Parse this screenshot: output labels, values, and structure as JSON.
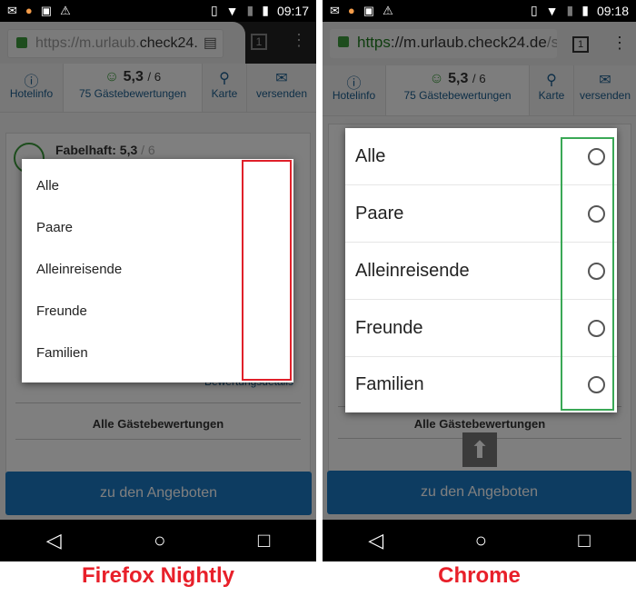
{
  "panels": [
    {
      "browser": "Firefox Nightly",
      "status": {
        "time": "09:17",
        "icons": [
          "gmail-icon",
          "cpu-icon",
          "android-icon",
          "warning-icon",
          "vibrate-icon",
          "wifi-icon",
          "no-sim-icon",
          "battery-icon"
        ]
      },
      "url": {
        "scheme": "https://",
        "host_start": "m.urlaub.",
        "host_main": "check24.",
        "rest": ""
      },
      "tab_count": "1",
      "nav_tabs": [
        {
          "label": "Hotelinfo",
          "icon": "info-icon"
        },
        {
          "score": "5,3",
          "of": "/ 6",
          "label": "75 Gästebewertungen",
          "icon": "smiley-icon"
        },
        {
          "label": "Karte",
          "icon": "map-pin-icon"
        },
        {
          "label": "versenden",
          "icon": "mail-icon"
        }
      ],
      "rating_title": "Fabelhaft: 5,3",
      "rating_of": "/ 6",
      "details_link": "Bewertungsdetails",
      "all_reviews": "Alle Gästebewertungen",
      "cta": "zu den Angeboten",
      "options": [
        "Alle",
        "Paare",
        "Alleinreisende",
        "Freunde",
        "Familien"
      ],
      "highlight_color": "#e0202a"
    },
    {
      "browser": "Chrome",
      "status": {
        "time": "09:18"
      },
      "url": {
        "scheme": "https",
        "host": "://m.urlaub.check24.de",
        "rest": "/s"
      },
      "tab_count": "1",
      "nav_tabs": [
        {
          "label": "Hotelinfo"
        },
        {
          "score": "5,3",
          "of": "/ 6",
          "label": "75 Gästebewertungen"
        },
        {
          "label": "Karte"
        },
        {
          "label": "versenden"
        }
      ],
      "all_reviews": "Alle Gästebewertungen",
      "cta": "zu den Angeboten",
      "options": [
        "Alle",
        "Paare",
        "Alleinreisende",
        "Freunde",
        "Familien"
      ],
      "highlight_color": "#3aa856"
    }
  ]
}
